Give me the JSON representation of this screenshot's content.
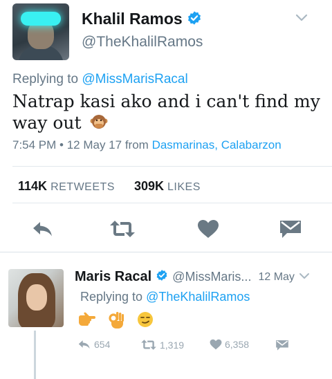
{
  "main_tweet": {
    "author_name": "Khalil Ramos",
    "handle": "@TheKhalilRamos",
    "replying_prefix": "Replying to ",
    "replying_to": "@MissMarisRacal",
    "text": "Natrap kasi ako and i can't find my way out",
    "emoji": "speak-no-evil-monkey",
    "timestamp": "7:54 PM • 12 May 17",
    "from_prefix": "from",
    "location": "Dasmarinas, Calabarzon",
    "retweets_count": "114K",
    "retweets_label": "RETWEETS",
    "likes_count": "309K",
    "likes_label": "LIKES",
    "icons": [
      "reply-icon",
      "retweet-icon",
      "heart-icon",
      "direct-message-icon"
    ]
  },
  "reply_tweet": {
    "author_name": "Maris Racal",
    "handle": "@MissMaris...",
    "time": "12 May",
    "replying_prefix": "Replying to ",
    "replying_to": "@TheKhalilRamos",
    "emojis": [
      "pointing-right-hand",
      "ok-hand",
      "smirking-face"
    ],
    "reply_count": "654",
    "retweet_count": "1,319",
    "like_count": "6,358"
  },
  "colors": {
    "link_blue": "#1da1f2",
    "verified_blue": "#1da1f2",
    "secondary_text": "#657786",
    "action_icon": "#6a7984",
    "divider": "#e1e8ed"
  }
}
